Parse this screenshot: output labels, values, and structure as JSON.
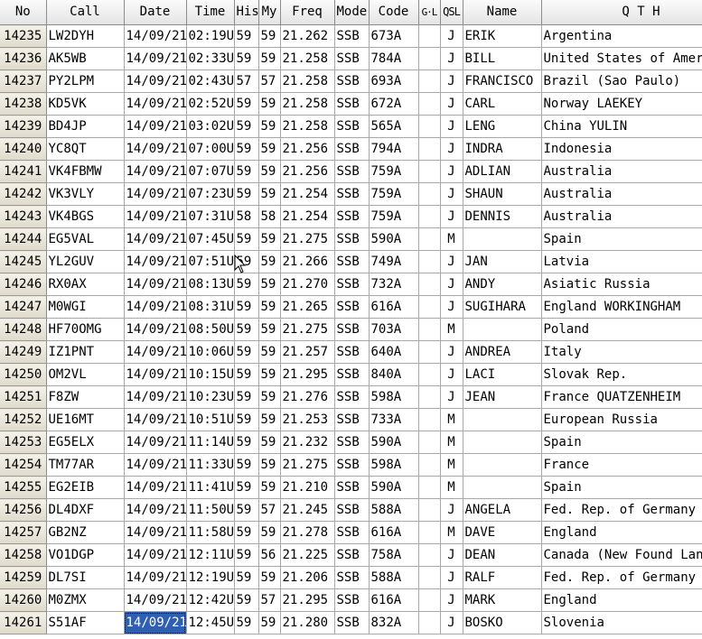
{
  "columns": {
    "no": "No",
    "call": "Call",
    "date": "Date",
    "time": "Time",
    "his": "His",
    "my": "My",
    "freq": "Freq",
    "mode": "Mode",
    "code": "Code",
    "gl": "G·L",
    "qsl": "QSL",
    "name": "Name",
    "qth": "Q T H"
  },
  "rows": [
    {
      "no": "14235",
      "call": "LW2DYH",
      "date": "14/09/21",
      "time": "02:19U",
      "his": "59",
      "my": "59",
      "freq": "21.262",
      "mode": "SSB",
      "code": "673A",
      "gl": "",
      "qsl": "J",
      "name": "ERIK",
      "qth": "Argentina"
    },
    {
      "no": "14236",
      "call": "AK5WB",
      "date": "14/09/21",
      "time": "02:33U",
      "his": "59",
      "my": "59",
      "freq": "21.258",
      "mode": "SSB",
      "code": "784A",
      "gl": "",
      "qsl": "J",
      "name": "BILL",
      "qth": "United States of Amer"
    },
    {
      "no": "14237",
      "call": "PY2LPM",
      "date": "14/09/21",
      "time": "02:43U",
      "his": "57",
      "my": "57",
      "freq": "21.258",
      "mode": "SSB",
      "code": "693A",
      "gl": "",
      "qsl": "J",
      "name": "FRANCISCO",
      "qth": "Brazil (Sao Paulo)"
    },
    {
      "no": "14238",
      "call": "KD5VK",
      "date": "14/09/21",
      "time": "02:52U",
      "his": "59",
      "my": "59",
      "freq": "21.258",
      "mode": "SSB",
      "code": "672A",
      "gl": "",
      "qsl": "J",
      "name": "CARL",
      "qth": "Norway LAEKEY"
    },
    {
      "no": "14239",
      "call": "BD4JP",
      "date": "14/09/21",
      "time": "03:02U",
      "his": "59",
      "my": "59",
      "freq": "21.258",
      "mode": "SSB",
      "code": "565A",
      "gl": "",
      "qsl": "J",
      "name": "LENG",
      "qth": "China YULIN"
    },
    {
      "no": "14240",
      "call": "YC8QT",
      "date": "14/09/21",
      "time": "07:00U",
      "his": "59",
      "my": "59",
      "freq": "21.256",
      "mode": "SSB",
      "code": "794A",
      "gl": "",
      "qsl": "J",
      "name": "INDRA",
      "qth": "Indonesia"
    },
    {
      "no": "14241",
      "call": "VK4FBMW",
      "date": "14/09/21",
      "time": "07:07U",
      "his": "59",
      "my": "59",
      "freq": "21.256",
      "mode": "SSB",
      "code": "759A",
      "gl": "",
      "qsl": "J",
      "name": "ADLIAN",
      "qth": "Australia"
    },
    {
      "no": "14242",
      "call": "VK3VLY",
      "date": "14/09/21",
      "time": "07:23U",
      "his": "59",
      "my": "59",
      "freq": "21.254",
      "mode": "SSB",
      "code": "759A",
      "gl": "",
      "qsl": "J",
      "name": "SHAUN",
      "qth": "Australia"
    },
    {
      "no": "14243",
      "call": "VK4BGS",
      "date": "14/09/21",
      "time": "07:31U",
      "his": "58",
      "my": "58",
      "freq": "21.254",
      "mode": "SSB",
      "code": "759A",
      "gl": "",
      "qsl": "J",
      "name": "DENNIS",
      "qth": "Australia"
    },
    {
      "no": "14244",
      "call": "EG5VAL",
      "date": "14/09/21",
      "time": "07:45U",
      "his": "59",
      "my": "59",
      "freq": "21.275",
      "mode": "SSB",
      "code": "590A",
      "gl": "",
      "qsl": "M",
      "name": "",
      "qth": "Spain"
    },
    {
      "no": "14245",
      "call": "YL2GUV",
      "date": "14/09/21",
      "time": "07:51U",
      "his": "59",
      "my": "59",
      "freq": "21.266",
      "mode": "SSB",
      "code": "749A",
      "gl": "",
      "qsl": "J",
      "name": "JAN",
      "qth": "Latvia"
    },
    {
      "no": "14246",
      "call": "RX0AX",
      "date": "14/09/21",
      "time": "08:13U",
      "his": "59",
      "my": "59",
      "freq": "21.270",
      "mode": "SSB",
      "code": "732A",
      "gl": "",
      "qsl": "J",
      "name": "ANDY",
      "qth": "Asiatic Russia"
    },
    {
      "no": "14247",
      "call": "M0WGI",
      "date": "14/09/21",
      "time": "08:31U",
      "his": "59",
      "my": "59",
      "freq": "21.265",
      "mode": "SSB",
      "code": "616A",
      "gl": "",
      "qsl": "J",
      "name": "SUGIHARA",
      "qth": "England  WORKINGHAM"
    },
    {
      "no": "14248",
      "call": "HF70OMG",
      "date": "14/09/21",
      "time": "08:50U",
      "his": "59",
      "my": "59",
      "freq": "21.275",
      "mode": "SSB",
      "code": "703A",
      "gl": "",
      "qsl": "M",
      "name": "",
      "qth": "Poland"
    },
    {
      "no": "14249",
      "call": "IZ1PNT",
      "date": "14/09/21",
      "time": "10:06U",
      "his": "59",
      "my": "59",
      "freq": "21.257",
      "mode": "SSB",
      "code": "640A",
      "gl": "",
      "qsl": "J",
      "name": "ANDREA",
      "qth": "Italy"
    },
    {
      "no": "14250",
      "call": "OM2VL",
      "date": "14/09/21",
      "time": "10:15U",
      "his": "59",
      "my": "59",
      "freq": "21.295",
      "mode": "SSB",
      "code": "840A",
      "gl": "",
      "qsl": "J",
      "name": "LACI",
      "qth": "Slovak Rep."
    },
    {
      "no": "14251",
      "call": "F8ZW",
      "date": "14/09/21",
      "time": "10:23U",
      "his": "59",
      "my": "59",
      "freq": "21.276",
      "mode": "SSB",
      "code": "598A",
      "gl": "",
      "qsl": "J",
      "name": "JEAN",
      "qth": "France QUATZENHEIM"
    },
    {
      "no": "14252",
      "call": "UE16MT",
      "date": "14/09/21",
      "time": "10:51U",
      "his": "59",
      "my": "59",
      "freq": "21.253",
      "mode": "SSB",
      "code": "733A",
      "gl": "",
      "qsl": "M",
      "name": "",
      "qth": "European Russia"
    },
    {
      "no": "14253",
      "call": "EG5ELX",
      "date": "14/09/21",
      "time": "11:14U",
      "his": "59",
      "my": "59",
      "freq": "21.232",
      "mode": "SSB",
      "code": "590A",
      "gl": "",
      "qsl": "M",
      "name": "",
      "qth": "Spain"
    },
    {
      "no": "14254",
      "call": "TM77AR",
      "date": "14/09/21",
      "time": "11:33U",
      "his": "59",
      "my": "59",
      "freq": "21.275",
      "mode": "SSB",
      "code": "598A",
      "gl": "",
      "qsl": "M",
      "name": "",
      "qth": "France"
    },
    {
      "no": "14255",
      "call": "EG2EIB",
      "date": "14/09/21",
      "time": "11:41U",
      "his": "59",
      "my": "59",
      "freq": "21.210",
      "mode": "SSB",
      "code": "590A",
      "gl": "",
      "qsl": "M",
      "name": "",
      "qth": "Spain"
    },
    {
      "no": "14256",
      "call": "DL4DXF",
      "date": "14/09/21",
      "time": "11:50U",
      "his": "59",
      "my": "57",
      "freq": "21.245",
      "mode": "SSB",
      "code": "588A",
      "gl": "",
      "qsl": "J",
      "name": "ANGELA",
      "qth": "Fed. Rep. of Germany"
    },
    {
      "no": "14257",
      "call": "GB2NZ",
      "date": "14/09/21",
      "time": "11:58U",
      "his": "59",
      "my": "59",
      "freq": "21.278",
      "mode": "SSB",
      "code": "616A",
      "gl": "",
      "qsl": "M",
      "name": "DAVE",
      "qth": "England"
    },
    {
      "no": "14258",
      "call": "VO1DGP",
      "date": "14/09/21",
      "time": "12:11U",
      "his": "59",
      "my": "56",
      "freq": "21.225",
      "mode": "SSB",
      "code": "758A",
      "gl": "",
      "qsl": "J",
      "name": "DEAN",
      "qth": "Canada (New Found Land"
    },
    {
      "no": "14259",
      "call": "DL7SI",
      "date": "14/09/21",
      "time": "12:19U",
      "his": "59",
      "my": "59",
      "freq": "21.206",
      "mode": "SSB",
      "code": "588A",
      "gl": "",
      "qsl": "J",
      "name": "RALF",
      "qth": "Fed. Rep. of Germany"
    },
    {
      "no": "14260",
      "call": "M0ZMX",
      "date": "14/09/21",
      "time": "12:42U",
      "his": "59",
      "my": "57",
      "freq": "21.295",
      "mode": "SSB",
      "code": "616A",
      "gl": "",
      "qsl": "J",
      "name": "MARK",
      "qth": "England"
    },
    {
      "no": "14261",
      "call": "S51AF",
      "date": "14/09/21",
      "time": "12:45U",
      "his": "59",
      "my": "59",
      "freq": "21.280",
      "mode": "SSB",
      "code": "832A",
      "gl": "",
      "qsl": "J",
      "name": "BOSKO",
      "qth": "Slovenia"
    }
  ],
  "selection": {
    "row_no": "14261",
    "column": "date"
  },
  "colors": {
    "selected_bg": "#2f5fb3",
    "header_bg": "#f0f0f0",
    "rownum_bg": "#ece9d8",
    "grid_line": "#a8a8a8"
  },
  "pointer": "mouse-pointer-icon"
}
